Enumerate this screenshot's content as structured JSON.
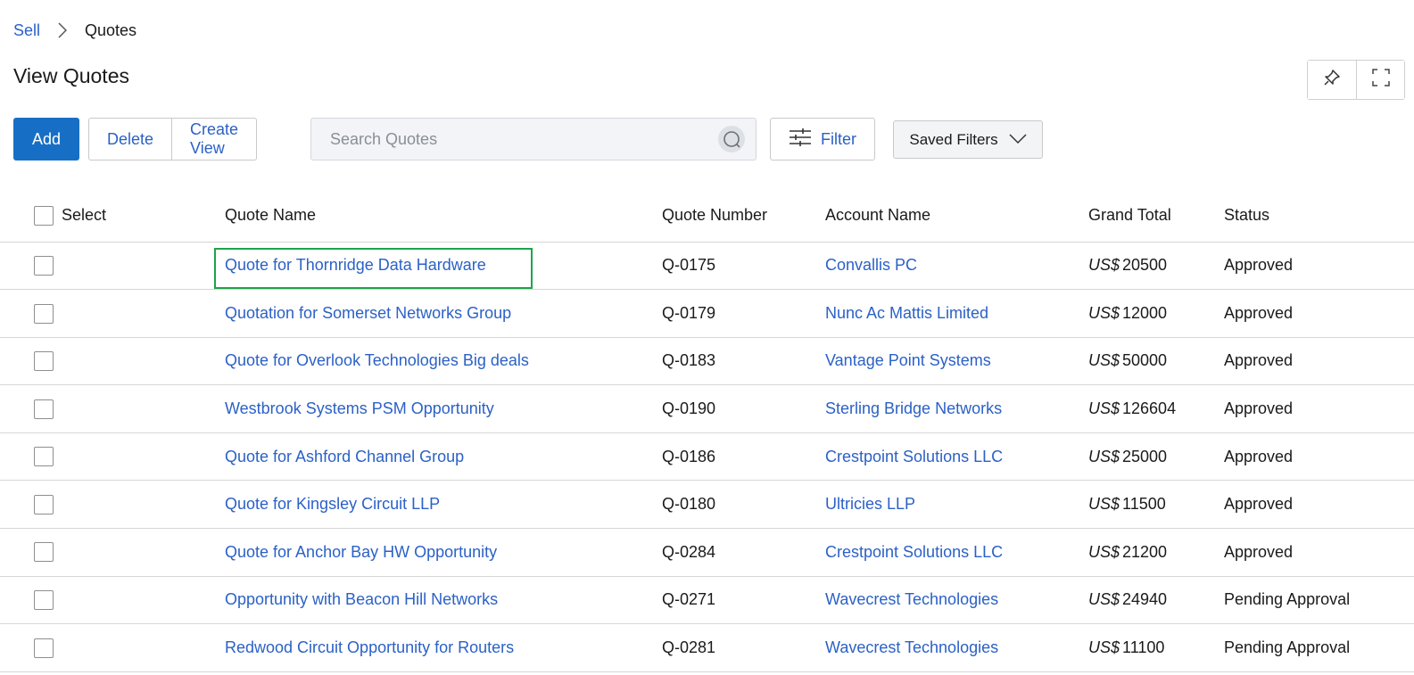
{
  "breadcrumb": {
    "parent": "Sell",
    "current": "Quotes"
  },
  "page_title": "View Quotes",
  "toolbar": {
    "add_label": "Add",
    "delete_label": "Delete",
    "create_view_label": "Create View",
    "search_placeholder": "Search Quotes",
    "filter_label": "Filter",
    "saved_filters_label": "Saved Filters"
  },
  "table": {
    "headers": {
      "select": "Select",
      "quote_name": "Quote Name",
      "quote_number": "Quote Number",
      "account_name": "Account Name",
      "grand_total": "Grand Total",
      "status": "Status"
    },
    "currency": "US$",
    "rows": [
      {
        "name": "Quote for Thornridge Data Hardware",
        "number": "Q-0175",
        "account": "Convallis PC",
        "total": "20500",
        "status": "Approved"
      },
      {
        "name": "Quotation for Somerset Networks Group",
        "number": "Q-0179",
        "account": "Nunc Ac Mattis Limited",
        "total": "12000",
        "status": "Approved"
      },
      {
        "name": "Quote for Overlook Technologies Big deals",
        "number": "Q-0183",
        "account": "Vantage Point Systems",
        "total": "50000",
        "status": "Approved"
      },
      {
        "name": "Westbrook Systems PSM Opportunity",
        "number": "Q-0190",
        "account": "Sterling Bridge Networks",
        "total": "126604",
        "status": "Approved"
      },
      {
        "name": "Quote for Ashford Channel Group",
        "number": "Q-0186",
        "account": "Crestpoint Solutions LLC",
        "total": "25000",
        "status": "Approved"
      },
      {
        "name": "Quote for Kingsley Circuit LLP",
        "number": "Q-0180",
        "account": "Ultricies LLP",
        "total": "11500",
        "status": "Approved"
      },
      {
        "name": "Quote for Anchor Bay HW Opportunity",
        "number": "Q-0284",
        "account": "Crestpoint Solutions LLC",
        "total": "21200",
        "status": "Approved"
      },
      {
        "name": "Opportunity with Beacon Hill Networks",
        "number": "Q-0271",
        "account": "Wavecrest Technologies",
        "total": "24940",
        "status": "Pending Approval"
      },
      {
        "name": "Redwood Circuit Opportunity for Routers",
        "number": "Q-0281",
        "account": "Wavecrest Technologies",
        "total": "11100",
        "status": "Pending Approval"
      }
    ]
  },
  "icons": {
    "chevron_right": "chevron-right-icon",
    "pin": "pin-icon",
    "expand": "expand-icon",
    "search": "search-icon",
    "filter": "filter-sliders-icon",
    "chevron_down": "chevron-down-icon"
  },
  "colors": {
    "primary": "#176fc5",
    "link": "#2b61c6",
    "highlight": "#1ea44a"
  }
}
